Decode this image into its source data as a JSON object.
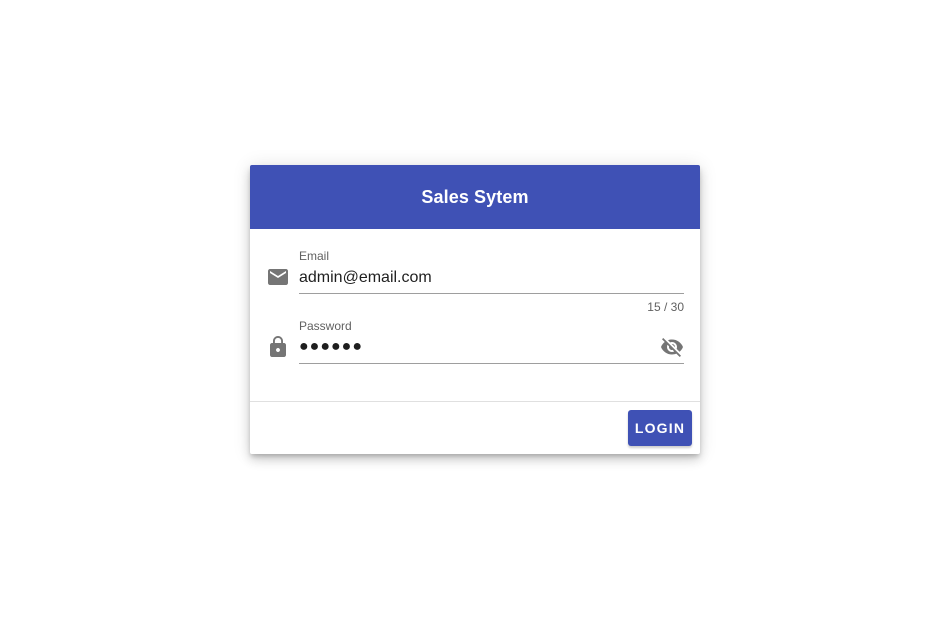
{
  "header": {
    "title": "Sales Sytem",
    "color": "#3f51b5"
  },
  "email": {
    "label": "Email",
    "value": "admin@email.com",
    "counter": "15 / 30",
    "icon": "email-icon"
  },
  "password": {
    "label": "Password",
    "masked_value": "●●●●●●",
    "icon": "lock-icon",
    "toggle_icon": "visibility-off-icon"
  },
  "actions": {
    "login_label": "LOGIN"
  }
}
